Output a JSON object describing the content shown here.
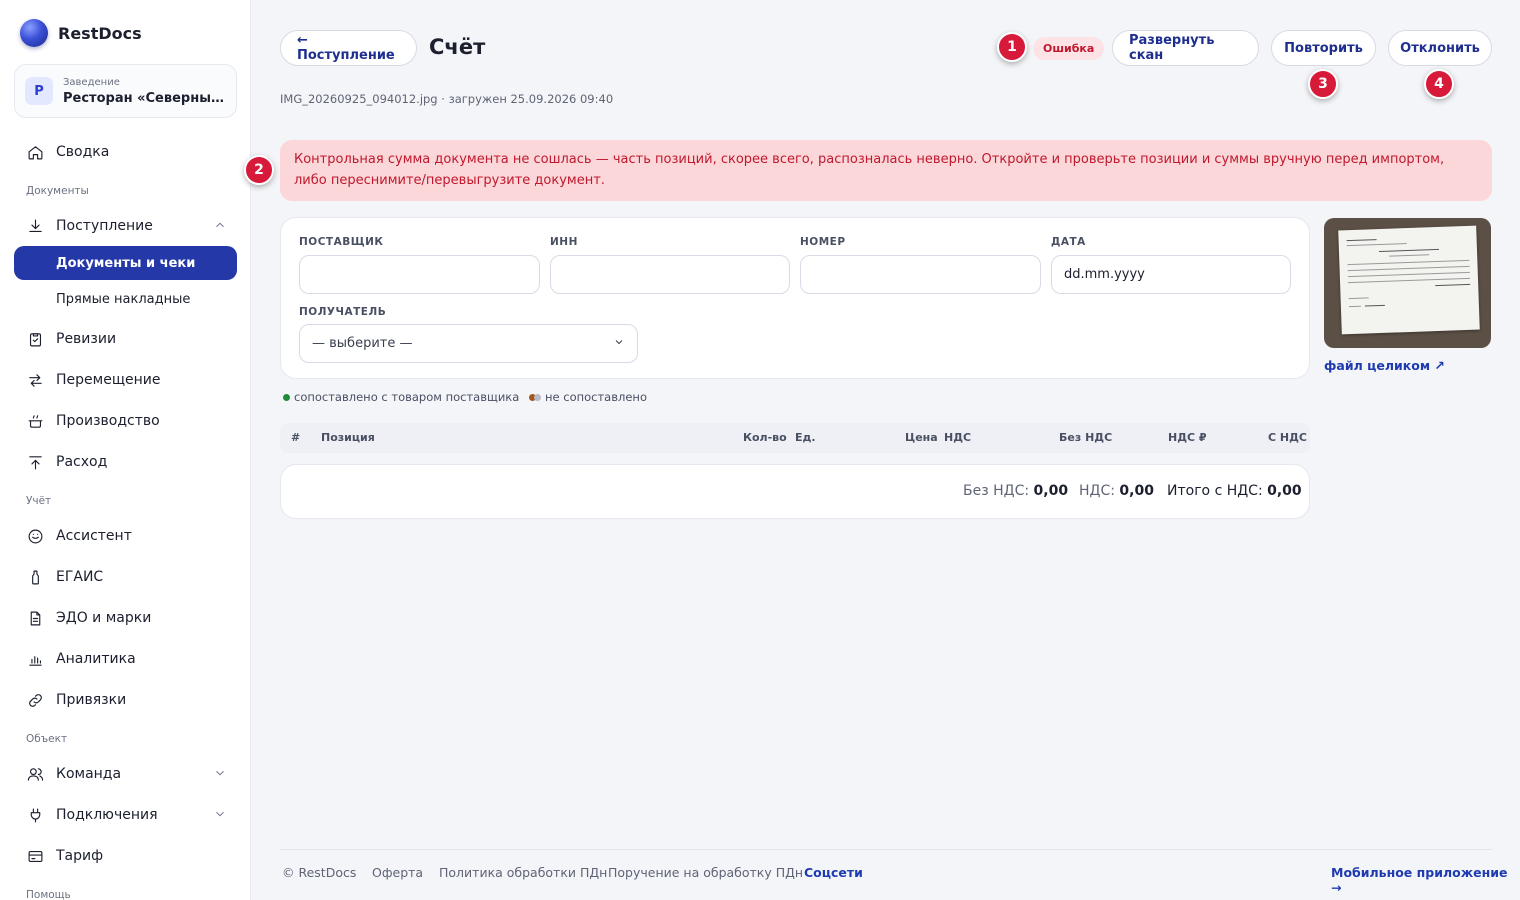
{
  "brand": {
    "name": "RestDocs"
  },
  "venue": {
    "avatar_letter": "Р",
    "label": "Заведение",
    "name": "Ресторан «Северный ..."
  },
  "sidebar": {
    "items": [
      {
        "label": "Сводка",
        "icon": "home-icon"
      },
      {
        "label": "Поступление",
        "icon": "download-icon"
      },
      {
        "label": "Документы и чеки"
      },
      {
        "label": "Прямые накладные"
      },
      {
        "label": "Ревизии",
        "icon": "clipboard-check-icon"
      },
      {
        "label": "Перемещение",
        "icon": "transfer-arrows-icon"
      },
      {
        "label": "Производство",
        "icon": "cooking-pot-icon"
      },
      {
        "label": "Расход",
        "icon": "upload-icon"
      },
      {
        "label": "Ассистент",
        "icon": "assistant-icon"
      },
      {
        "label": "ЕГАИС",
        "icon": "bottle-icon"
      },
      {
        "label": "ЭДО и марки",
        "icon": "document-icon"
      },
      {
        "label": "Аналитика",
        "icon": "bar-chart-icon"
      },
      {
        "label": "Привязки",
        "icon": "link-icon"
      },
      {
        "label": "Команда",
        "icon": "users-icon"
      },
      {
        "label": "Подключения",
        "icon": "plug-icon"
      },
      {
        "label": "Тариф",
        "icon": "card-icon"
      }
    ],
    "sections": {
      "documents": "Документы",
      "accounting": "Учёт",
      "object": "Объект",
      "help": "Помощь"
    }
  },
  "header": {
    "back_label": "← Поступление",
    "title": "Счёт",
    "status": "Ошибка",
    "expand_scan": "Развернуть скан",
    "retry": "Повторить",
    "reject": "Отклонить",
    "file_meta": "IMG_20260925_094012.jpg · загружен 25.09.2026 09:40"
  },
  "markers": [
    "1",
    "2",
    "3",
    "4"
  ],
  "alert": {
    "text": "Контрольная сумма документа не сошлась — часть позиций, скорее всего, распозналась неверно. Откройте и проверьте позиции и суммы вручную перед импортом, либо переснимите/перевыгрузите документ."
  },
  "form": {
    "supplier_label": "ПОСТАВЩИК",
    "supplier_value": "",
    "inn_label": "ИНН",
    "inn_value": "",
    "number_label": "НОМЕР",
    "number_value": "",
    "date_label": "ДАТА",
    "date_placeholder": "dd.mm.yyyy",
    "recipient_label": "ПОЛУЧАТЕЛЬ",
    "recipient_value": "— выберите —"
  },
  "scan": {
    "link_label": "файл целиком ↗"
  },
  "legend": {
    "matched": "сопоставлено с товаром поставщика",
    "unmatched": "не сопоставлено",
    "matched_color": "#1f8a3a",
    "unmatched_color_a": "#a5561c",
    "unmatched_color_b": "#b8bcc6"
  },
  "table": {
    "columns": [
      "#",
      "Позиция",
      "Кол-во",
      "Ед.",
      "Цена",
      "НДС",
      "Без НДС",
      "НДС ₽",
      "С НДС"
    ]
  },
  "totals": {
    "without_vat_label": "Без НДС:",
    "without_vat": "0,00",
    "vat_label": "НДС:",
    "vat": "0,00",
    "total_label": "Итого с НДС:",
    "total": "0,00"
  },
  "footer": {
    "copyright": "© RestDocs",
    "offer": "Оферта",
    "privacy": "Политика обработки ПДн",
    "assignment": "Поручение на обработку ПДн",
    "social": "Соцсети",
    "mobile": "Мобильное приложение →"
  },
  "colors": {
    "accent": "#2438a8",
    "error": "#c0182e",
    "marker": "#d7193a"
  }
}
